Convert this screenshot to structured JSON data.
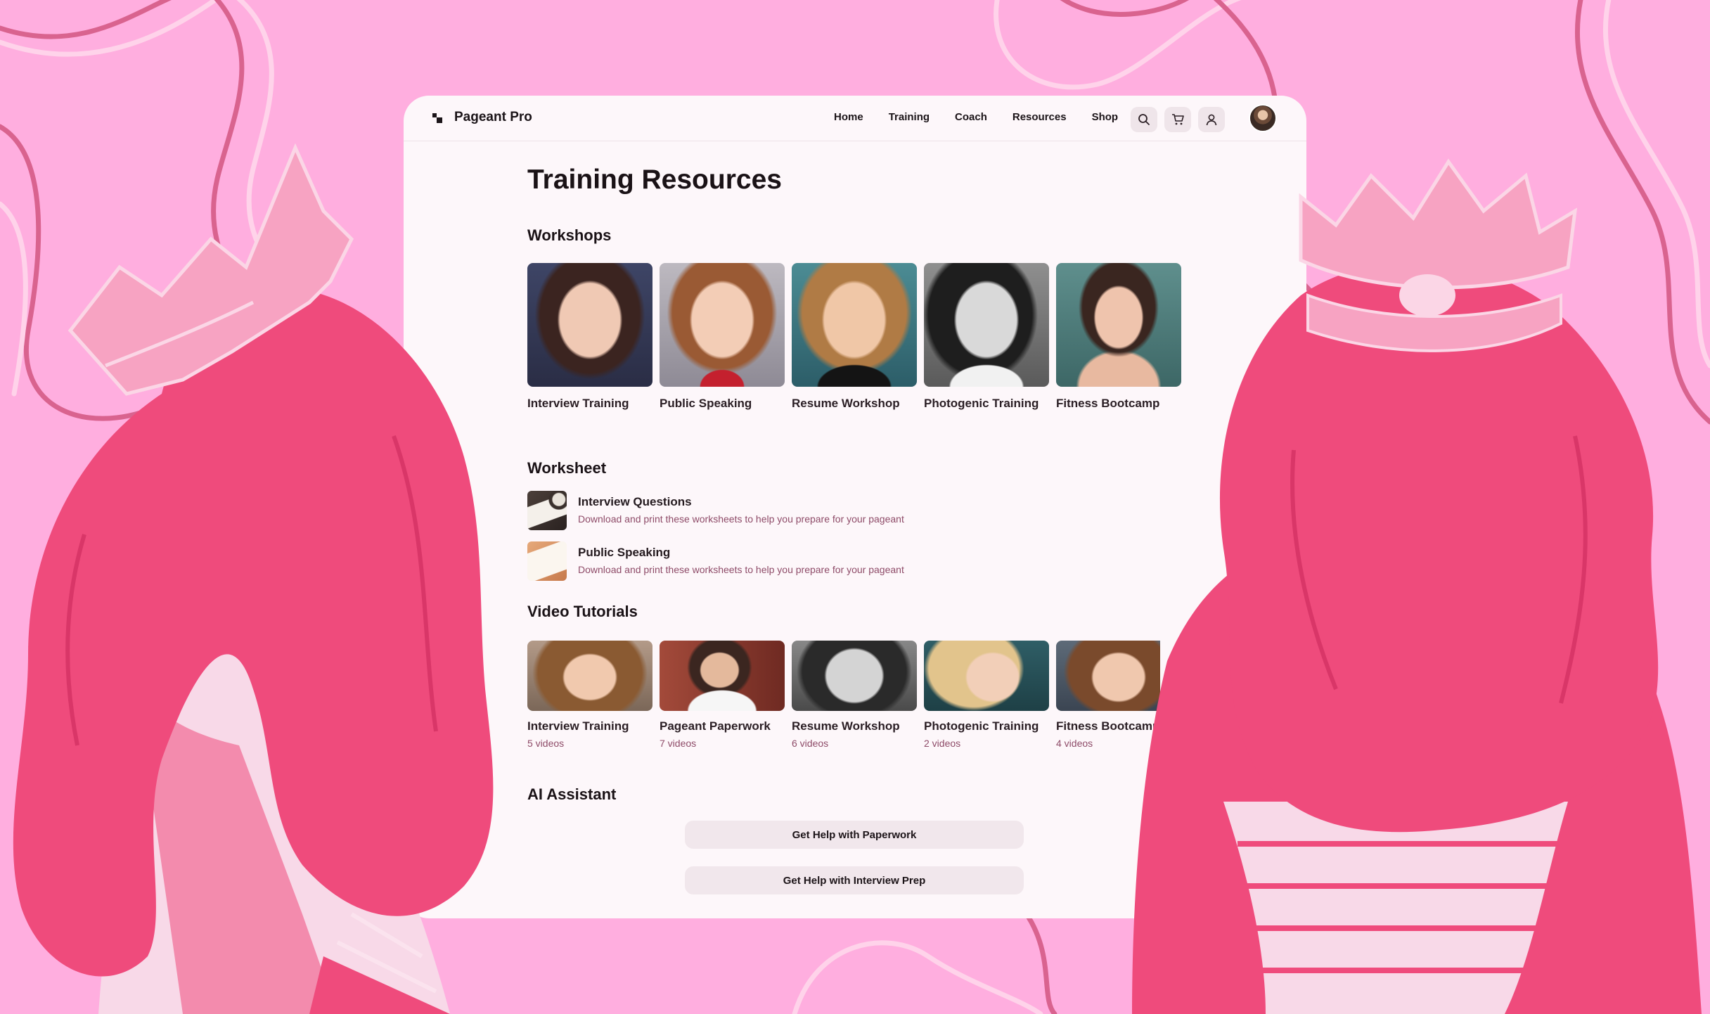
{
  "colors": {
    "background": "#ffaedf",
    "accent": "#f04f7e",
    "muted_text": "#8e4b68",
    "window": "#fdf7fa"
  },
  "nav": {
    "brand": "Pageant Pro",
    "links": [
      "Home",
      "Training",
      "Coach",
      "Resources",
      "Shop"
    ],
    "icons": [
      "search-icon",
      "cart-icon",
      "user-icon"
    ]
  },
  "page": {
    "title": "Training Resources"
  },
  "workshops": {
    "heading": "Workshops",
    "items": [
      {
        "label": "Interview Training"
      },
      {
        "label": "Public Speaking"
      },
      {
        "label": "Resume Workshop"
      },
      {
        "label": "Photogenic Training"
      },
      {
        "label": "Fitness Bootcamp"
      }
    ]
  },
  "worksheet": {
    "heading": "Worksheet",
    "items": [
      {
        "title": "Interview Questions",
        "description": "Download and print these worksheets to help you prepare for your pageant"
      },
      {
        "title": "Public Speaking",
        "description": "Download and print these worksheets to help you prepare for your pageant"
      }
    ]
  },
  "video_tutorials": {
    "heading": "Video Tutorials",
    "items": [
      {
        "title": "Interview Training",
        "count": "5 videos"
      },
      {
        "title": "Pageant Paperwork",
        "count": "7 videos"
      },
      {
        "title": "Resume Workshop",
        "count": "6 videos"
      },
      {
        "title": "Photogenic Training",
        "count": "2 videos"
      },
      {
        "title": "Fitness Bootcamp",
        "count": "4 videos"
      }
    ]
  },
  "ai_assistant": {
    "heading": "AI Assistant",
    "buttons": [
      "Get Help with Paperwork",
      "Get Help with Interview Prep"
    ]
  }
}
